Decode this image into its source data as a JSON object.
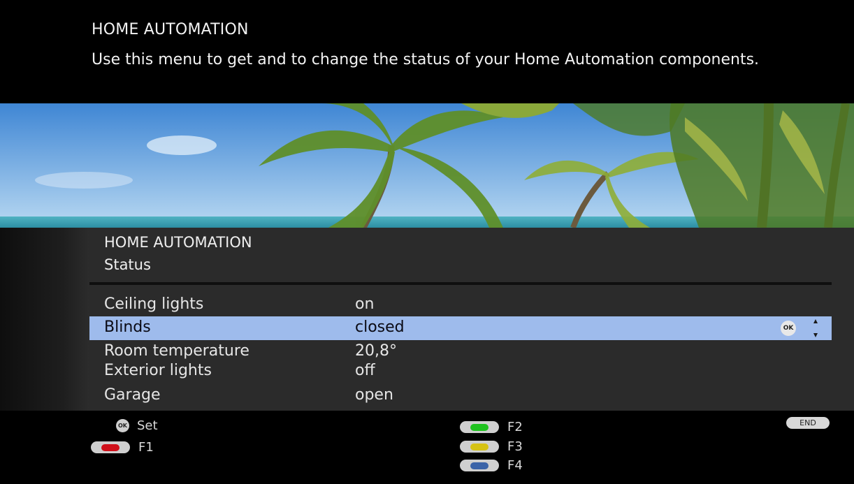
{
  "header": {
    "title": "HOME AUTOMATION",
    "description": "Use this menu to get and to change the status of your Home Automation components."
  },
  "banner": {
    "image": "tropical-beach-palm-trees"
  },
  "menu": {
    "title": "HOME AUTOMATION",
    "subtitle": "Status",
    "items": [
      {
        "label": "Ceiling lights",
        "value": "on",
        "selected": false
      },
      {
        "label": "Blinds",
        "value": "closed",
        "selected": true
      },
      {
        "label": "Room temperature",
        "value": "20,8°",
        "selected": false
      },
      {
        "label": "Exterior lights",
        "value": "off",
        "selected": false
      },
      {
        "label": "Garage",
        "value": "open",
        "selected": false
      }
    ],
    "ok_badge": "OK",
    "scroll_icon": "up-down-arrows-icon"
  },
  "footer": {
    "ok_icon": "OK",
    "set_label": "Set",
    "f1_label": "F1",
    "f2_label": "F2",
    "f3_label": "F3",
    "f4_label": "F4",
    "end_label": "END"
  },
  "colors": {
    "selection": "#9ebbec",
    "red": "#d0101a",
    "green": "#1fc21f",
    "yellow": "#d6c214",
    "blue": "#3a63a8"
  }
}
